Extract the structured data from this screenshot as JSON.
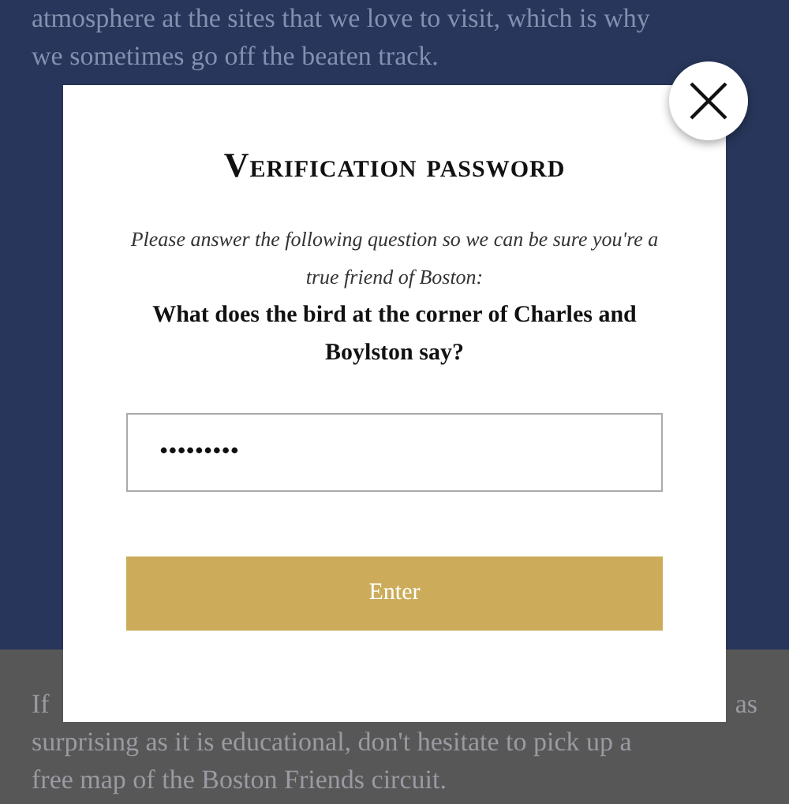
{
  "background": {
    "top_lines": [
      "atmosphere at the sites that we love to visit, which is why",
      "we sometimes go off the beaten track."
    ],
    "bottom_first_left": "If",
    "bottom_first_right": "as",
    "bottom_lines": [
      "surprising as it is educational, don't hesitate to pick up a",
      "free map of the Boston Friends circuit."
    ]
  },
  "dialog": {
    "title": "Verification password",
    "intro": "Please answer the following question so we can be sure you're a true friend of Boston:",
    "question": "What does the bird at the corner of Charles and Boylston say?",
    "password": "•••••••••",
    "button": "Enter"
  }
}
